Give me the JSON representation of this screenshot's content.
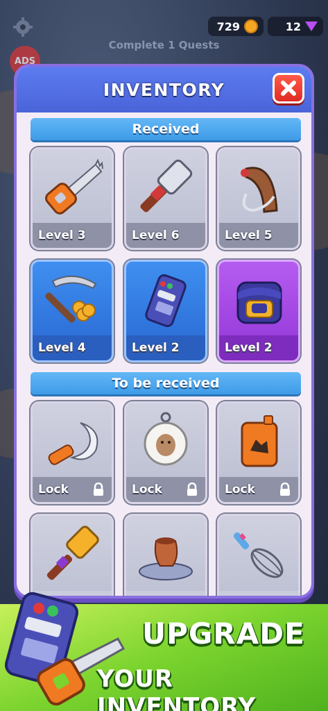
{
  "topbar": {
    "coins": "729",
    "gems": "12"
  },
  "background": {
    "quest_text": "Complete 1 Quests",
    "ads_label": "ADS"
  },
  "panel": {
    "title": "INVENTORY",
    "close_icon": "close-x-icon",
    "sections": {
      "received": "Received",
      "to_be_received": "To be received"
    },
    "received_items": [
      {
        "icon": "saw-icon",
        "label": "Level 3",
        "tier": "gray"
      },
      {
        "icon": "hammer-icon",
        "label": "Level 6",
        "tier": "gray"
      },
      {
        "icon": "horn-icon",
        "label": "Level 5",
        "tier": "gray"
      },
      {
        "icon": "pickaxe-coins-icon",
        "label": "Level 4",
        "tier": "blue"
      },
      {
        "icon": "remote-control-icon",
        "label": "Level 2",
        "tier": "blue"
      },
      {
        "icon": "backpack-icon",
        "label": "Level 2",
        "tier": "purple"
      }
    ],
    "pending_items": [
      {
        "icon": "sickle-icon",
        "label": "Lock"
      },
      {
        "icon": "sheep-keychain-icon",
        "label": "Lock"
      },
      {
        "icon": "fuel-canister-icon",
        "label": "Lock"
      },
      {
        "icon": "mallet-icon",
        "label": ""
      },
      {
        "icon": "pottery-wheel-icon",
        "label": ""
      },
      {
        "icon": "whisk-icon",
        "label": ""
      }
    ]
  },
  "promo": {
    "line1": "UPGRADE",
    "line2": "YOUR INVENTORY"
  },
  "colors": {
    "header_blue": "#4a64d8",
    "section_blue": "#3f9be8",
    "close_red": "#e02b22",
    "tier_blue": "#2d70d9",
    "tier_purple": "#9a3fdc",
    "promo_green": "#7bd32e"
  }
}
